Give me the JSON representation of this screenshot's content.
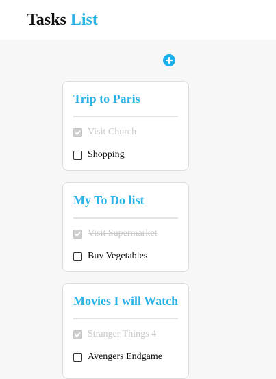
{
  "app": {
    "title_main": "Tasks",
    "title_accent": "List"
  },
  "toolbar": {
    "add_icon": "plus-circle-icon"
  },
  "colors": {
    "accent": "#2ab3e6",
    "add_button": "#18b0ea",
    "done_text": "#c9c9c9",
    "background": "#f7f7f7"
  },
  "lists": [
    {
      "title": "Trip to Paris",
      "tasks": [
        {
          "label": "Visit Church",
          "done": true
        },
        {
          "label": "Shopping",
          "done": false
        }
      ]
    },
    {
      "title": "My To Do list",
      "tasks": [
        {
          "label": "Visit Supermarket",
          "done": true
        },
        {
          "label": "Buy Vegetables",
          "done": false
        }
      ]
    },
    {
      "title": "Movies I will Watch",
      "tasks": [
        {
          "label": "Stranger Things 4",
          "done": true
        },
        {
          "label": "Avengers Endgame",
          "done": false
        }
      ]
    }
  ]
}
